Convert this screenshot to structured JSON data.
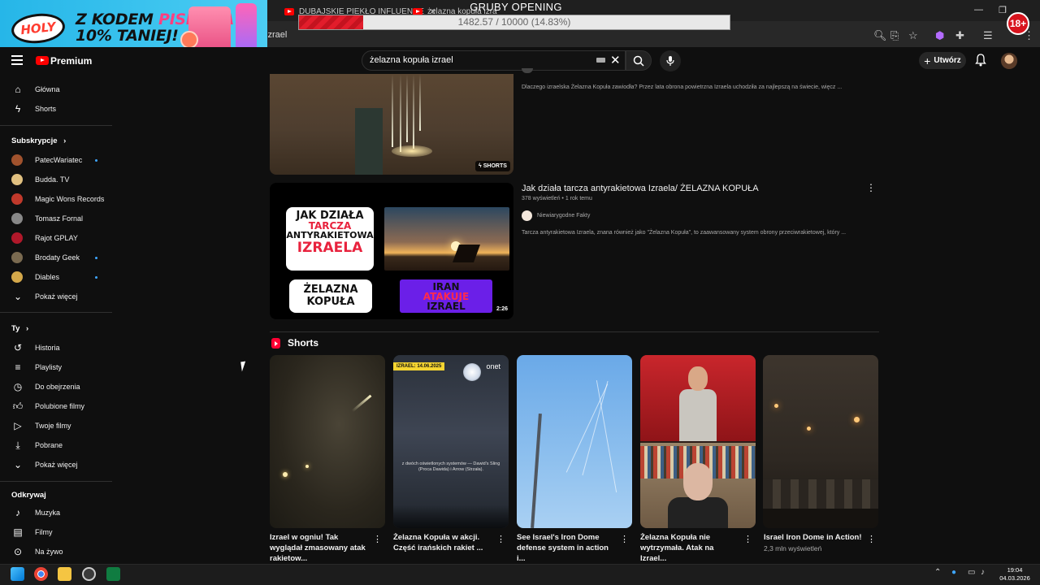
{
  "browser": {
    "tabs": [
      {
        "title": "DUBAJSKIE PIEKŁO INFLUENCE"
      },
      {
        "title": "żelazna kopuła izra"
      }
    ],
    "address_fragment": "izrael"
  },
  "overlay": {
    "title": "GRUBY OPENING",
    "progress_text": "1482.57 / 10000 (14.83%)",
    "progress_fraction": 0.1483,
    "promo_line1": "Z KODEM",
    "promo_highlight": "PISICELA",
    "promo_line2": "10% TANIEJ!",
    "promo_brand": "HOLY",
    "age_badge": "18+"
  },
  "masthead": {
    "logo_label": "Premium",
    "search_value": "żelazna kopuła izrael",
    "create_label": "Utwórz"
  },
  "sidebar": {
    "main": [
      {
        "label": "Główna",
        "icon": "home-icon"
      },
      {
        "label": "Shorts",
        "icon": "shorts-icon"
      }
    ],
    "subs_heading": "Subskrypcje",
    "subscriptions": [
      {
        "label": "PatecWariatec",
        "new": true,
        "color": "#a0522d"
      },
      {
        "label": "Budda. TV",
        "new": false,
        "color": "#e0c080"
      },
      {
        "label": "Magic Wons Records",
        "new": false,
        "color": "#c0392b"
      },
      {
        "label": "Tomasz Fornal",
        "new": false,
        "color": "#888888"
      },
      {
        "label": "Rajot GPLAY",
        "new": false,
        "color": "#b0182a"
      },
      {
        "label": "Brodaty Geek",
        "new": true,
        "color": "#7a6a50"
      },
      {
        "label": "Diables",
        "new": true,
        "color": "#d4a84a"
      }
    ],
    "show_more": "Pokaż więcej",
    "you_heading": "Ty",
    "you_items": [
      {
        "label": "Historia",
        "icon": "history-icon"
      },
      {
        "label": "Playlisty",
        "icon": "playlist-icon"
      },
      {
        "label": "Do obejrzenia",
        "icon": "watch-later-icon"
      },
      {
        "label": "Polubione filmy",
        "icon": "like-icon"
      },
      {
        "label": "Twoje filmy",
        "icon": "your-videos-icon"
      },
      {
        "label": "Pobrane",
        "icon": "download-icon"
      },
      {
        "label": "Pokaż więcej",
        "icon": "chevron-down-icon"
      }
    ],
    "explore_heading": "Odkrywaj",
    "explore_items": [
      {
        "label": "Muzyka",
        "icon": "music-icon"
      },
      {
        "label": "Filmy",
        "icon": "film-icon"
      },
      {
        "label": "Na żywo",
        "icon": "live-icon"
      }
    ]
  },
  "results": {
    "video1": {
      "desc": "Dlaczego izraelska Żelazna Kopuła zawiodła? Przez lata obrona powietrzna Izraela uchodziła za najlepszą na świecie, więcz ...",
      "badge": "SHORTS"
    },
    "video2": {
      "title": "Jak działa tarcza antyrakietowa Izraela/ ŻELAZNA KOPUŁA",
      "views": "378 wyświetleń",
      "age": "1 rok temu",
      "channel": "Niewiarygodne Fakty",
      "desc": "Tarcza antyrakietowa Izraela, znana również jako \"Żelazna Kopuła\", to zaawansowany system obrony przeciwrakietowej, który ...",
      "duration": "2:26",
      "thumb_card1": [
        "JAK DZIAŁA",
        "TARCZA",
        "ANTYRAKIETOWA",
        "IZRAELA"
      ],
      "thumb_card2": [
        "ŻELAZNA",
        "KOPUŁA"
      ],
      "thumb_card3": [
        "IRAN",
        "ATAKUJE",
        "IZRAEL"
      ]
    }
  },
  "shorts": {
    "heading": "Shorts",
    "items": [
      {
        "title": "Izrael w ogniu! Tak wyglądał zmasowany atak rakietow..."
      },
      {
        "title": "Żelazna Kopuła w akcji. Część irańskich rakiet ...",
        "overlay_date": "IZRAEL: 14.06.2025",
        "overlay_brand": "onet",
        "overlay_caption": "z dwóch oświetlonych systemów — Dawid's Sling (Proca Dawida) i Arrow (Strzała)."
      },
      {
        "title": "See Israel's Iron Dome defense system in action i..."
      },
      {
        "title": "Żelazna Kopuła nie wytrzymała. Atak na Izrael..."
      },
      {
        "title": "Israel Iron Dome in Action!",
        "meta": "2,3 mln wyświetleń"
      }
    ]
  },
  "taskbar": {
    "time": "19:04",
    "date": "04.03.2026"
  }
}
